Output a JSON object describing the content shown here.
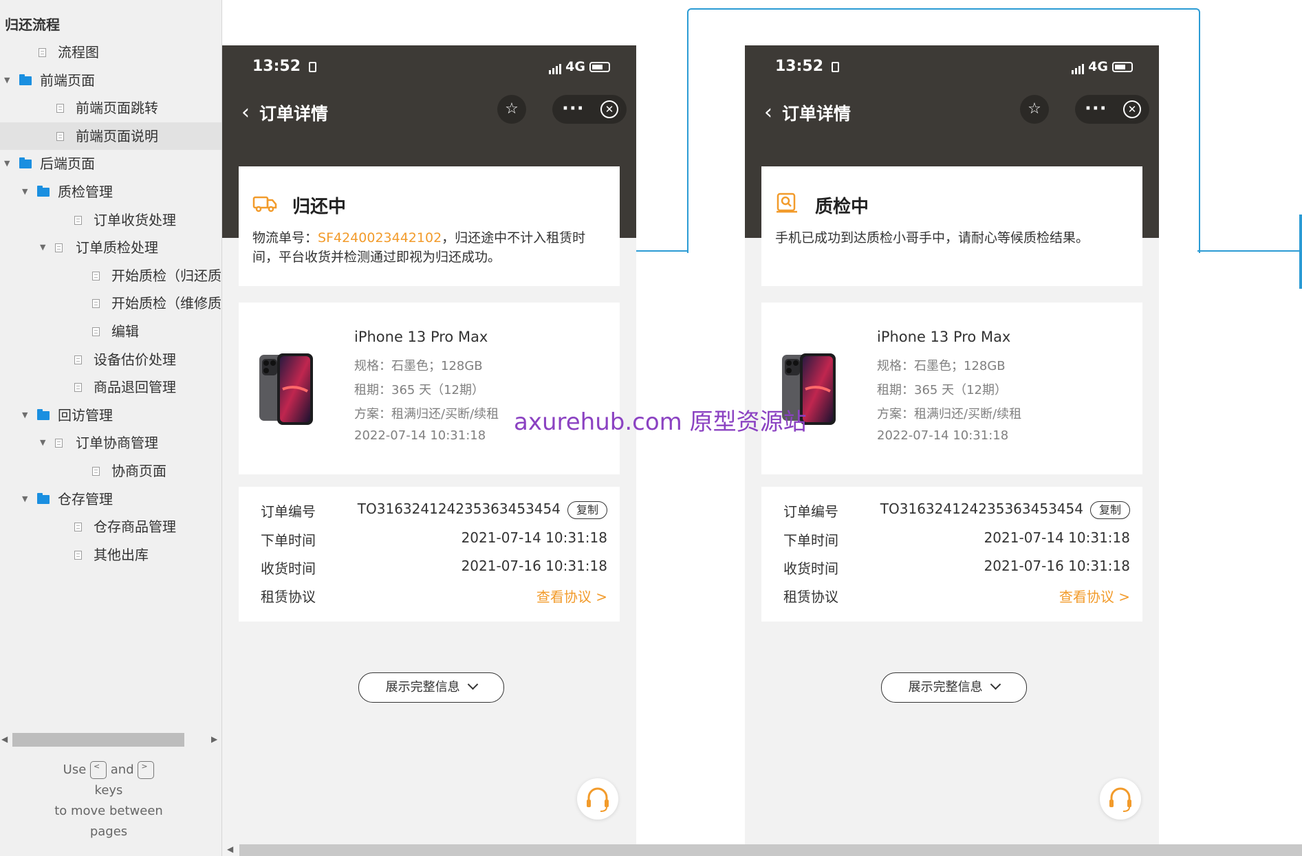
{
  "sidebar": {
    "title": "归还流程",
    "items": [
      {
        "label": "流程图",
        "type": "page",
        "depth": 1
      },
      {
        "label": "前端页面",
        "type": "folder",
        "depth": 0,
        "expanded": true
      },
      {
        "label": "前端页面跳转",
        "type": "page",
        "depth": 2
      },
      {
        "label": "前端页面说明",
        "type": "page",
        "depth": 2,
        "selected": true
      },
      {
        "label": "后端页面",
        "type": "folder",
        "depth": 0,
        "expanded": true
      },
      {
        "label": "质检管理",
        "type": "folder",
        "depth": 1,
        "expanded": true
      },
      {
        "label": "订单收货处理",
        "type": "page",
        "depth": 3
      },
      {
        "label": "订单质检处理",
        "type": "page",
        "depth": 2,
        "expanded": true
      },
      {
        "label": "开始质检（归还质检",
        "type": "page",
        "depth": 4
      },
      {
        "label": "开始质检（维修质检",
        "type": "page",
        "depth": 4
      },
      {
        "label": "编辑",
        "type": "page",
        "depth": 4
      },
      {
        "label": "设备估价处理",
        "type": "page",
        "depth": 3
      },
      {
        "label": "商品退回管理",
        "type": "page",
        "depth": 3
      },
      {
        "label": "回访管理",
        "type": "folder",
        "depth": 1,
        "expanded": true
      },
      {
        "label": "订单协商管理",
        "type": "page",
        "depth": 2,
        "expanded": true
      },
      {
        "label": "协商页面",
        "type": "page",
        "depth": 4
      },
      {
        "label": "仓存管理",
        "type": "folder",
        "depth": 1,
        "expanded": true
      },
      {
        "label": "仓存商品管理",
        "type": "page",
        "depth": 3
      },
      {
        "label": "其他出库",
        "type": "page",
        "depth": 3
      }
    ],
    "hint": {
      "use": "Use",
      "key_prev": "<",
      "and": "and",
      "key_next": ">",
      "keys": "keys",
      "line2": "to move between",
      "line3": "pages"
    }
  },
  "phones": [
    {
      "status_time": "13:52",
      "network": "4G",
      "nav_title": "订单详情",
      "status_title": "归还中",
      "status_desc_prefix": "物流单号：",
      "tracking_no": "SF4240023442102",
      "status_desc_suffix": "，归还途中不计入租赁时间，平台收货并检测通过即视为归还成功。",
      "product_name": "iPhone 13 Pro Max",
      "spec": "规格：石墨色；128GB",
      "term": "租期：365 天（12期）",
      "plan": "方案：租满归还/买断/续租",
      "product_time": "2022-07-14 10:31:18",
      "order_no_label": "订单编号",
      "order_no": "TO316324124235363453454",
      "copy_label": "复制",
      "order_time_label": "下单时间",
      "order_time": "2021-07-14 10:31:18",
      "receive_time_label": "收货时间",
      "receive_time": "2021-07-16 10:31:18",
      "agreement_label": "租赁协议",
      "agreement_link": "查看协议 >",
      "expand_label": "展示完整信息"
    },
    {
      "status_time": "13:52",
      "network": "4G",
      "nav_title": "订单详情",
      "status_title": "质检中",
      "status_desc_prefix": "手机已成功到达质检小哥手中，请耐心等候质检结果。",
      "tracking_no": "",
      "status_desc_suffix": "",
      "product_name": "iPhone 13 Pro Max",
      "spec": "规格：石墨色；128GB",
      "term": "租期：365 天（12期）",
      "plan": "方案：租满归还/买断/续租",
      "product_time": "2022-07-14 10:31:18",
      "order_no_label": "订单编号",
      "order_no": "TO316324124235363453454",
      "copy_label": "复制",
      "order_time_label": "下单时间",
      "order_time": "2021-07-14 10:31:18",
      "receive_time_label": "收货时间",
      "receive_time": "2021-07-16 10:31:18",
      "agreement_label": "租赁协议",
      "agreement_link": "查看协议 >",
      "expand_label": "展示完整信息"
    }
  ],
  "watermark": "axurehub.com 原型资源站",
  "colors": {
    "accent_orange": "#f29b2b",
    "connector_blue": "#2b9bd4",
    "header_dark": "#3d3a36",
    "folder_blue": "#1a8fe0",
    "watermark_purple": "#8b42c2"
  }
}
